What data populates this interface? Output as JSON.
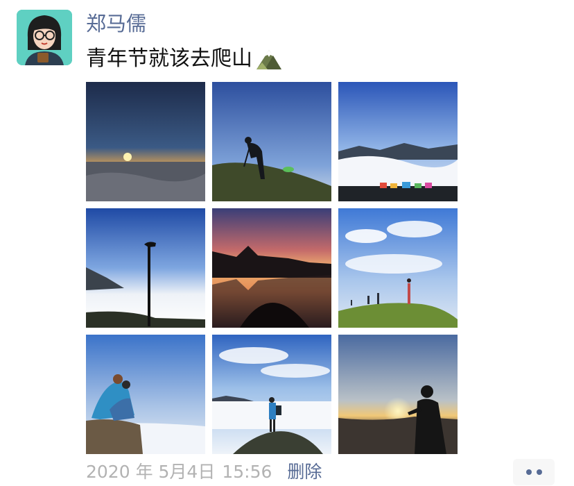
{
  "post": {
    "author": "郑马儒",
    "text": "青年节就该去爬山",
    "text_emoji": "mountain-icon",
    "date": "2020 年 5月4日",
    "time": "15:56",
    "delete_label": "删除"
  },
  "photos": [
    {
      "name": "photo-sunrise-sea-of-clouds"
    },
    {
      "name": "photo-hiker-silhouette"
    },
    {
      "name": "photo-tents-above-clouds"
    },
    {
      "name": "photo-trekking-pole"
    },
    {
      "name": "photo-peak-reflection-sunset"
    },
    {
      "name": "photo-hikers-on-grassy-summit"
    },
    {
      "name": "photo-couple-on-rock"
    },
    {
      "name": "photo-hiker-on-cliff"
    },
    {
      "name": "photo-sunset-silhouette"
    }
  ],
  "colors": {
    "name_link": "#576b95",
    "timestamp": "#b2b2b2",
    "text": "#111111"
  },
  "icons": {
    "more": "more-dots-icon"
  }
}
